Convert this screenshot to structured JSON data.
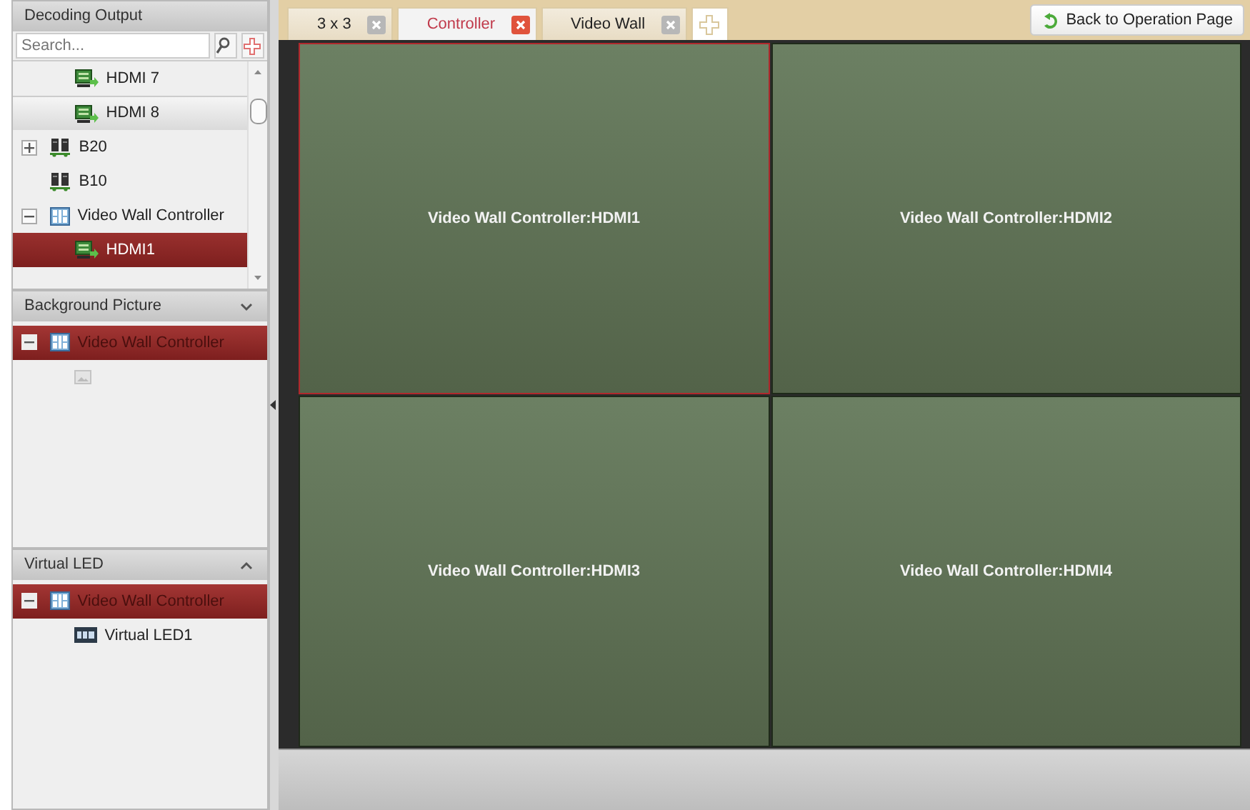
{
  "panels": [
    {
      "title": "Decoding Output",
      "search": {
        "placeholder": "Search..."
      },
      "tree": [
        {
          "children": [
            {
              "label": "HDMI 7",
              "kind": "output",
              "selected": false,
              "highlighted": false
            },
            {
              "label": "HDMI 8",
              "kind": "output",
              "selected": false,
              "highlighted": true
            }
          ]
        },
        {
          "label": "B20",
          "kind": "decoder",
          "expanded": false,
          "toggle": true,
          "selected": false,
          "highlighted": false
        },
        {
          "label": "B10",
          "kind": "decoder",
          "toggle": false,
          "selected": false,
          "highlighted": false
        },
        {
          "label": "Video Wall Controller",
          "kind": "controller",
          "expanded": true,
          "toggle": true,
          "selected": false,
          "highlighted": false,
          "children": [
            {
              "label": "HDMI1",
              "kind": "output",
              "selected": true,
              "highlighted": false
            }
          ]
        }
      ]
    },
    {
      "title": "Background Picture",
      "expanded": false,
      "tree": [
        {
          "label": "Video Wall Controller",
          "kind": "controller",
          "expanded": true,
          "toggle": true,
          "selected": true,
          "highlighted": false
        }
      ]
    },
    {
      "title": "Virtual LED",
      "expanded": true,
      "tree": [
        {
          "label": "Video Wall Controller",
          "kind": "controller",
          "expanded": true,
          "toggle": true,
          "selected": true,
          "highlighted": false,
          "children": [
            {
              "label": "Virtual LED1",
              "kind": "led",
              "selected": false,
              "highlighted": false
            }
          ]
        }
      ]
    }
  ],
  "tabs": [
    {
      "label": "3 x 3",
      "selected": false
    },
    {
      "label": "Controller",
      "selected": true
    },
    {
      "label": "Video Wall",
      "selected": false
    }
  ],
  "back_button": "Back to Operation Page",
  "wall": [
    {
      "label": "Video Wall Controller:HDMI1",
      "selected": true
    },
    {
      "label": "Video Wall Controller:HDMI2",
      "selected": false
    },
    {
      "label": "Video Wall Controller:HDMI3",
      "selected": false
    },
    {
      "label": "Video Wall Controller:HDMI4",
      "selected": false
    }
  ]
}
